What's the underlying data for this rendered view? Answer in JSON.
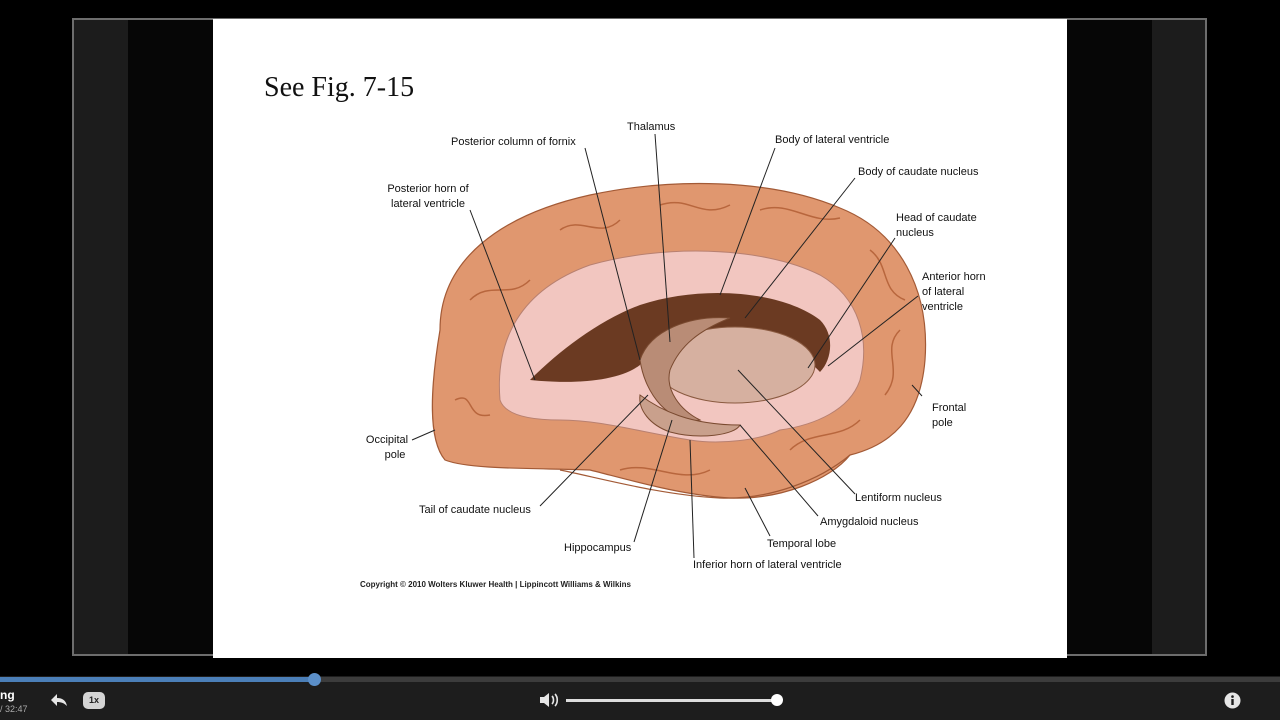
{
  "slide": {
    "title": "See Fig. 7-15",
    "copyright": "Copyright © 2010 Wolters Kluwer Health | Lippincott Williams & Wilkins",
    "labels": {
      "posterior_column_fornix": "Posterior column of fornix",
      "thalamus": "Thalamus",
      "body_lateral_ventricle": "Body of lateral ventricle",
      "body_caudate": "Body of caudate nucleus",
      "posterior_horn_1": "Posterior horn of",
      "posterior_horn_2": "lateral ventricle",
      "head_caudate_1": "Head of caudate",
      "head_caudate_2": "nucleus",
      "anterior_horn_1": "Anterior horn",
      "anterior_horn_2": "of lateral",
      "anterior_horn_3": "ventricle",
      "frontal_pole_1": "Frontal",
      "frontal_pole_2": "pole",
      "occipital_pole_1": "Occipital",
      "occipital_pole_2": "pole",
      "lentiform": "Lentiform nucleus",
      "tail_caudate": "Tail of caudate nucleus",
      "amygdaloid": "Amygdaloid nucleus",
      "temporal_lobe": "Temporal lobe",
      "hippocampus": "Hippocampus",
      "inferior_horn": "Inferior horn of lateral ventricle"
    }
  },
  "player": {
    "title_truncated": "ng",
    "time_truncated": "/ 32:47",
    "speed_label": "1x",
    "progress_fraction": 0.245,
    "volume_fraction": 1.0,
    "icons": [
      "replay-icon",
      "volume-icon",
      "info-icon"
    ],
    "accent_color": "#4b7fb8"
  }
}
